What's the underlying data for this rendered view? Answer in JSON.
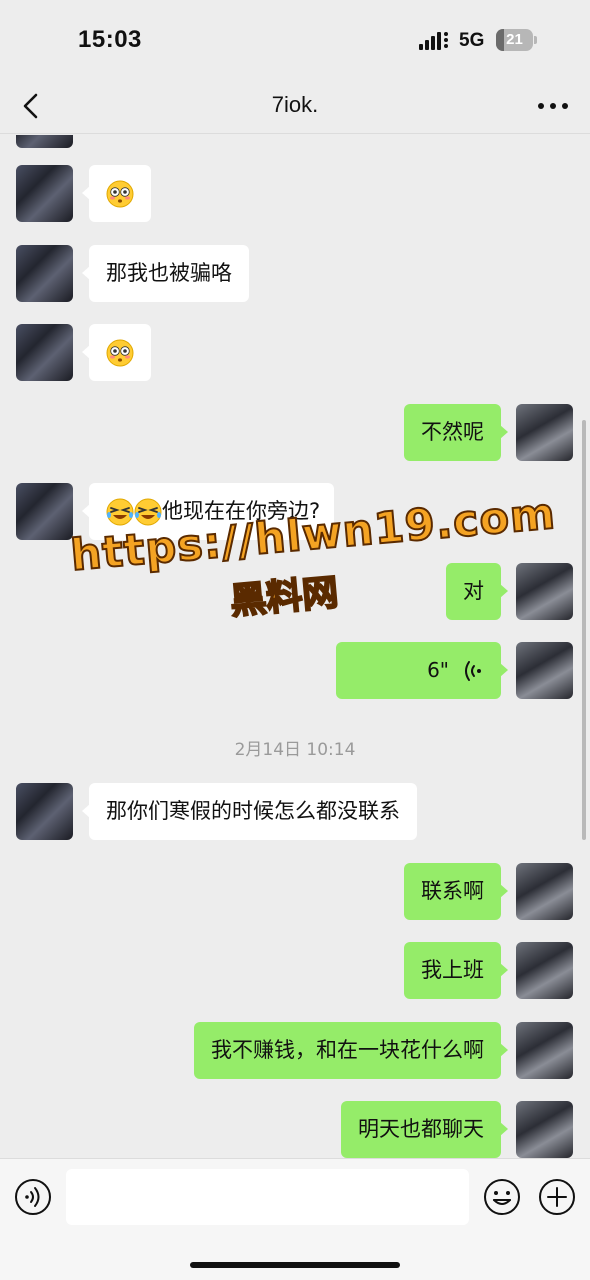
{
  "status_bar": {
    "time": "15:03",
    "network": "5G",
    "battery": "21",
    "battery_level": 0.21
  },
  "header": {
    "title": "7iok."
  },
  "messages": [
    {
      "side": "in",
      "kind": "emoji",
      "emoji": "flushed-face"
    },
    {
      "side": "in",
      "kind": "text",
      "text": "那我也被骗咯"
    },
    {
      "side": "in",
      "kind": "emoji",
      "emoji": "flushed-face"
    },
    {
      "side": "out",
      "kind": "text",
      "text": "不然呢"
    },
    {
      "side": "in",
      "kind": "text",
      "emoji_prefix": [
        "rolling-laugh-face",
        "rolling-laugh-face"
      ],
      "text": "他现在在你旁边?"
    },
    {
      "side": "out",
      "kind": "text",
      "text": "对"
    },
    {
      "side": "out",
      "kind": "voice",
      "duration": "6\""
    },
    {
      "kind": "timestamp",
      "text": "2月14日 10:14"
    },
    {
      "side": "in",
      "kind": "text",
      "text": "那你们寒假的时候怎么都没联系"
    },
    {
      "side": "out",
      "kind": "text",
      "text": "联系啊"
    },
    {
      "side": "out",
      "kind": "text",
      "text": "我上班"
    },
    {
      "side": "out",
      "kind": "text",
      "text": "我不赚钱，和在一块花什么啊"
    },
    {
      "side": "out",
      "kind": "text",
      "text": "明天也都聊天"
    }
  ],
  "watermark": {
    "line1": "https://hlwn19.com",
    "line2": "黑料网"
  },
  "input_bar": {
    "placeholder": ""
  },
  "colors": {
    "background": "#ededed",
    "outgoing_bubble": "#95ec69",
    "incoming_bubble": "#ffffff",
    "watermark": "#f4a323"
  }
}
